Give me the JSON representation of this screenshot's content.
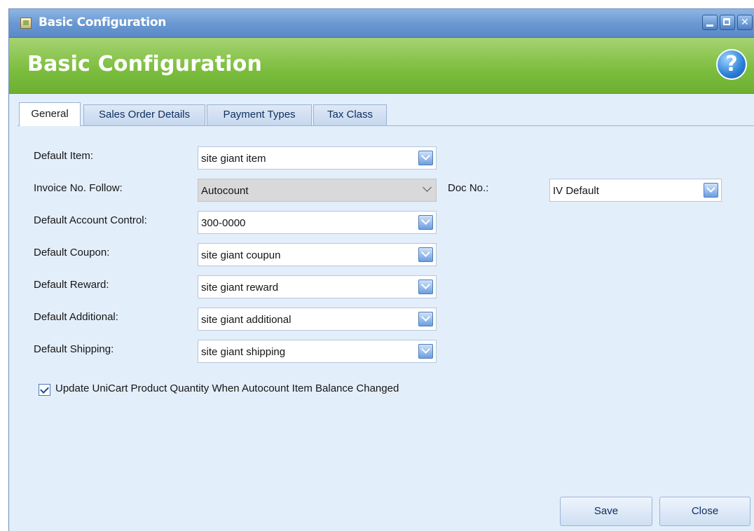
{
  "window": {
    "title": "Basic Configuration"
  },
  "banner": {
    "title": "Basic Configuration",
    "help_glyph": "?"
  },
  "tabs": [
    {
      "label": "General",
      "active": true
    },
    {
      "label": "Sales Order Details",
      "active": false
    },
    {
      "label": "Payment Types",
      "active": false
    },
    {
      "label": "Tax Class",
      "active": false
    }
  ],
  "form": {
    "default_item": {
      "label": "Default Item:",
      "value": "site giant item"
    },
    "invoice_no_follow": {
      "label": "Invoice No. Follow:",
      "value": "Autocount",
      "disabled": true
    },
    "doc_no": {
      "label": "Doc No.:",
      "value": "IV Default"
    },
    "default_account_control": {
      "label": "Default Account Control:",
      "value": "300-0000"
    },
    "default_coupon": {
      "label": "Default Coupon:",
      "value": "site giant coupun"
    },
    "default_reward": {
      "label": "Default Reward:",
      "value": "site giant reward"
    },
    "default_additional": {
      "label": "Default Additional:",
      "value": "site giant additional"
    },
    "default_shipping": {
      "label": "Default Shipping:",
      "value": "site giant shipping"
    },
    "update_quantity": {
      "label": "Update UniCart Product Quantity When Autocount Item Balance Changed",
      "checked": true
    }
  },
  "buttons": {
    "save": "Save",
    "close": "Close"
  },
  "colors": {
    "title_bar": "#6a99d2",
    "banner": "#7bbd3d",
    "panel": "#e3eefb"
  }
}
